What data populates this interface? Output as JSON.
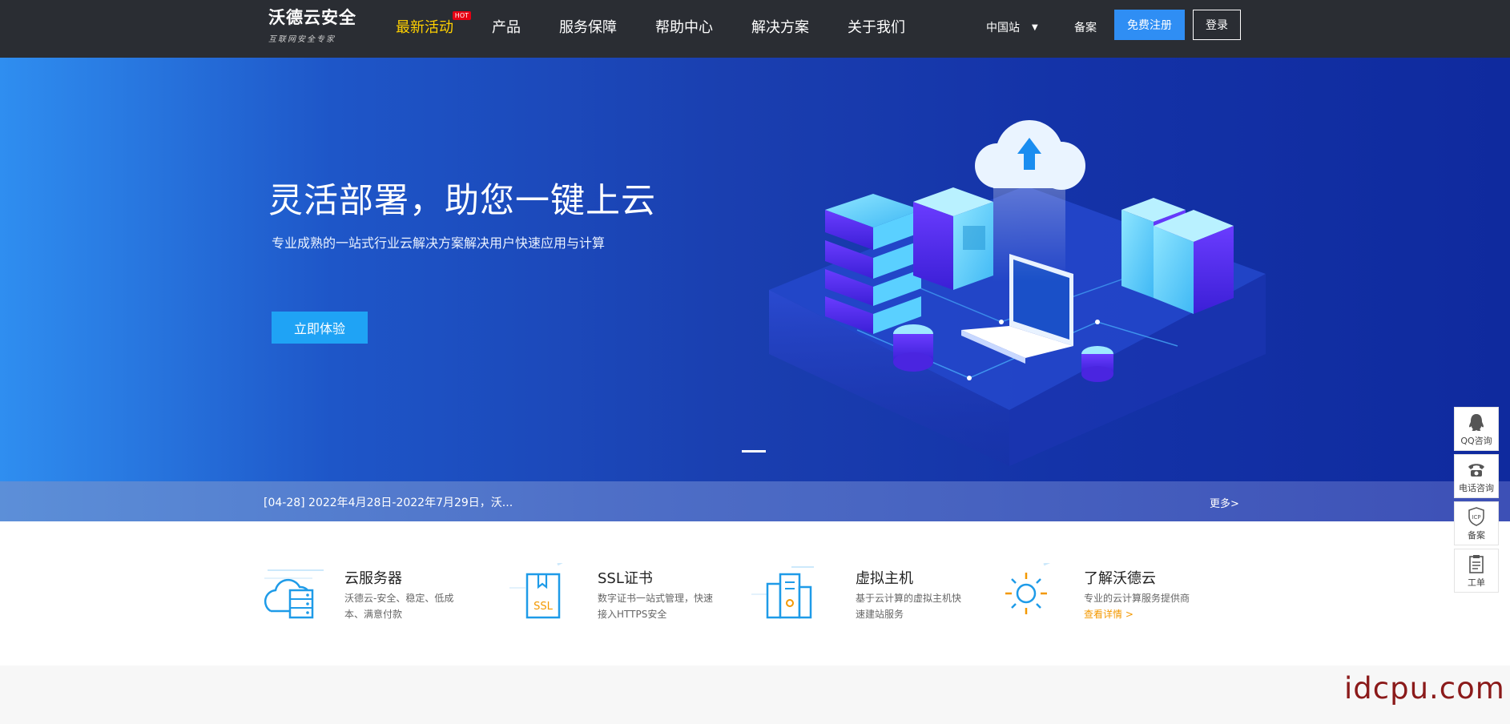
{
  "header": {
    "logo_name": "沃德云安全",
    "logo_slogan": "互联网安全专家",
    "nav": [
      {
        "label": "最新活动",
        "badge": "HOT"
      },
      {
        "label": "产品"
      },
      {
        "label": "服务保障"
      },
      {
        "label": "帮助中心"
      },
      {
        "label": "解决方案"
      },
      {
        "label": "关于我们"
      }
    ],
    "region": "中国站",
    "region_arrow": "▼",
    "beian": "备案",
    "register": "免费注册",
    "login": "登录"
  },
  "hero": {
    "title": "灵活部署，助您一键上云",
    "subtitle": "专业成熟的一站式行业云解决方案解决用户快速应用与计算",
    "button": "立即体验"
  },
  "notice": {
    "text": "[04-28] 2022年4月28日-2022年7月29日，沃...",
    "more": "更多>"
  },
  "features": [
    {
      "title": "云服务器",
      "desc_line1": "沃德云-安全、稳定、低成",
      "desc_line2": "本、满意付款",
      "icon": "cloud-server-icon"
    },
    {
      "title": "SSL证书",
      "desc_line1": "数字证书一站式管理，快速",
      "desc_line2": "接入HTTPS安全",
      "icon_text": "SSL",
      "icon": "ssl-certificate-icon"
    },
    {
      "title": "虚拟主机",
      "desc_line1": "基于云计算的虚拟主机快",
      "desc_line2": "速建站服务",
      "icon": "virtual-host-icon"
    },
    {
      "title": "了解沃德云",
      "desc_line1": "专业的云计算服务提供商",
      "link": "查看详情 >",
      "icon": "sun-gear-icon"
    }
  ],
  "side_tools": [
    {
      "label": "QQ咨询",
      "icon": "qq-icon"
    },
    {
      "label": "电话咨询",
      "icon": "phone-icon"
    },
    {
      "label": "备案",
      "icon_text": "ICP",
      "icon": "icp-shield-icon"
    },
    {
      "label": "工单",
      "icon": "clipboard-icon"
    }
  ],
  "watermark": "idcpu.com",
  "colors": {
    "topbar": "#2a2d33",
    "active_nav": "#ffd100",
    "register_button": "#2f8ef4",
    "hero_button": "#1fa3f5",
    "accent_link": "#f39800",
    "watermark": "#8b1a1a"
  }
}
